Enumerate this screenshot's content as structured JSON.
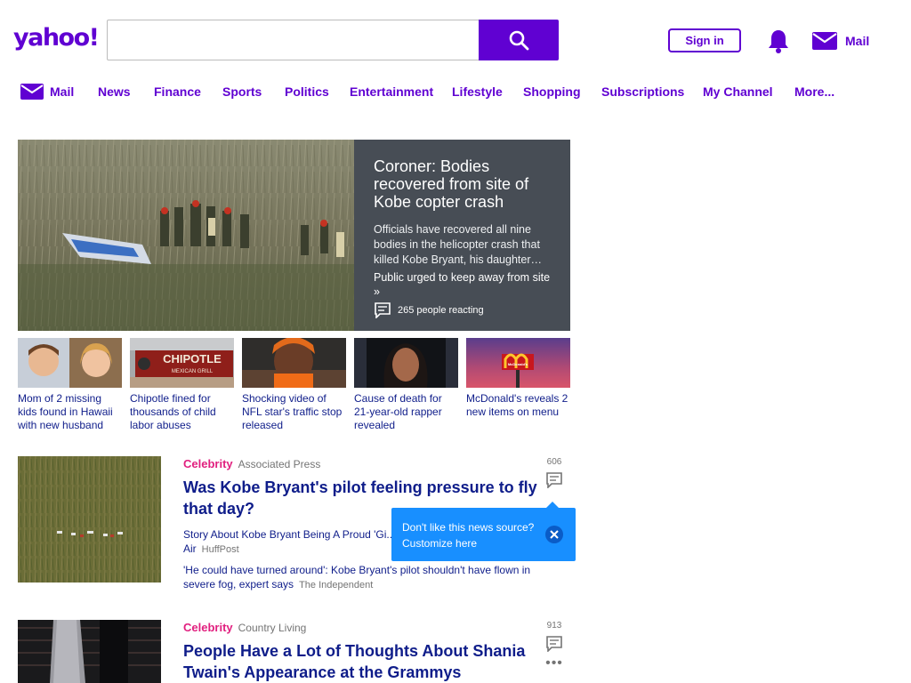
{
  "header": {
    "logo_text": "yahoo!",
    "search": {
      "value": "",
      "placeholder": ""
    },
    "signin_label": "Sign in",
    "mail_label": "Mail"
  },
  "nav": {
    "items": [
      {
        "label": "Mail",
        "icon": "mail-icon"
      },
      {
        "label": "News"
      },
      {
        "label": "Finance"
      },
      {
        "label": "Sports"
      },
      {
        "label": "Politics"
      },
      {
        "label": "Entertainment"
      },
      {
        "label": "Lifestyle"
      },
      {
        "label": "Shopping"
      },
      {
        "label": "Subscriptions"
      },
      {
        "label": "My Channel"
      },
      {
        "label": "More..."
      }
    ]
  },
  "hero": {
    "title": "Coroner: Bodies recovered from site of Kobe copter crash",
    "summary": "Officials have recovered all nine bodies in the helicopter crash that killed Kobe Bryant, his daughter…",
    "related": "Public urged to keep away from site »",
    "reactions": "265 people reacting"
  },
  "thumbs": [
    {
      "caption": "Mom of 2 missing kids found in Hawaii with new husband"
    },
    {
      "caption": "Chipotle fined for thousands of child labor abuses",
      "sign_text": "CHIPOTLE",
      "sign_sub": "MEXICAN GRILL"
    },
    {
      "caption": "Shocking video of NFL star's traffic stop released"
    },
    {
      "caption": "Cause of death for 21-year-old rapper revealed"
    },
    {
      "caption": "McDonald's reveals 2 new items on menu",
      "sign_text": "McDonald's"
    }
  ],
  "stream": [
    {
      "category": "Celebrity",
      "source": "Associated Press",
      "title": "Was Kobe Bryant's pilot feeling pressure to fly that day?",
      "comment_count": "606",
      "related": [
        {
          "text": "Story About Kobe Bryant Being A Proud 'Gi... Anchor To Cry On-Air",
          "source": "HuffPost"
        },
        {
          "text": "'He could have turned around': Kobe Bryant's pilot shouldn't have flown in severe fog, expert says",
          "source": "The Independent"
        }
      ]
    },
    {
      "category": "Celebrity",
      "source": "Country Living",
      "title": "People Have a Lot of Thoughts About Shania Twain's Appearance at the Grammys",
      "comment_count": "913"
    }
  ],
  "tooltip": {
    "text": "Don't like this news source? Customize here"
  },
  "colors": {
    "brand": "#6001d2",
    "link": "#0f1d8a",
    "category": "#e1207f",
    "tooltip": "#188fff",
    "hero_panel": "#474d55"
  }
}
